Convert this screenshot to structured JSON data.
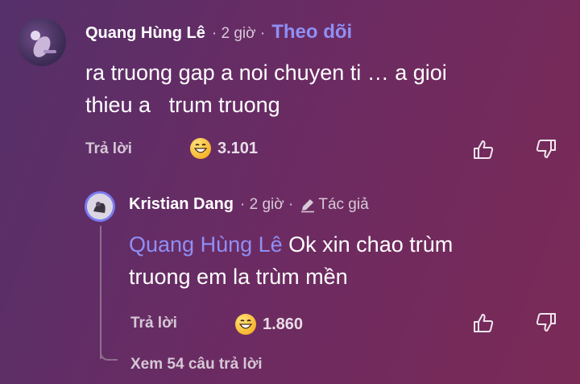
{
  "comment": {
    "author": "Quang Hùng Lê",
    "time": "· 2 giờ ·",
    "follow_label": "Theo dõi",
    "text_line1": "ra truong gap a noi chuyen ti … a gioi",
    "text_line2": "thieu a   trum truong",
    "reply_label": "Trả lời",
    "reaction_count": "3.101",
    "reaction_icon": "grinning-face-emoji",
    "like_icon": "thumb-up-icon",
    "dislike_icon": "thumb-down-icon"
  },
  "reply": {
    "author": "Kristian Dang",
    "time": "· 2 giờ ·",
    "badge_label": "Tác giả",
    "badge_icon": "pencil-icon",
    "mention": "Quang Hùng Lê",
    "text_line1_rest": " Ok xin chao trùm",
    "text_line2": "truong em la trùm mền",
    "reply_label": "Trả lời",
    "reaction_count": "1.860",
    "reaction_icon": "grinning-face-emoji",
    "like_icon": "thumb-up-icon",
    "dislike_icon": "thumb-down-icon"
  },
  "see_more_label": "Xem 54 câu trả lời",
  "colors": {
    "accent": "#8f8ff5",
    "background_start": "#55306a",
    "background_end": "#7b2a56"
  }
}
